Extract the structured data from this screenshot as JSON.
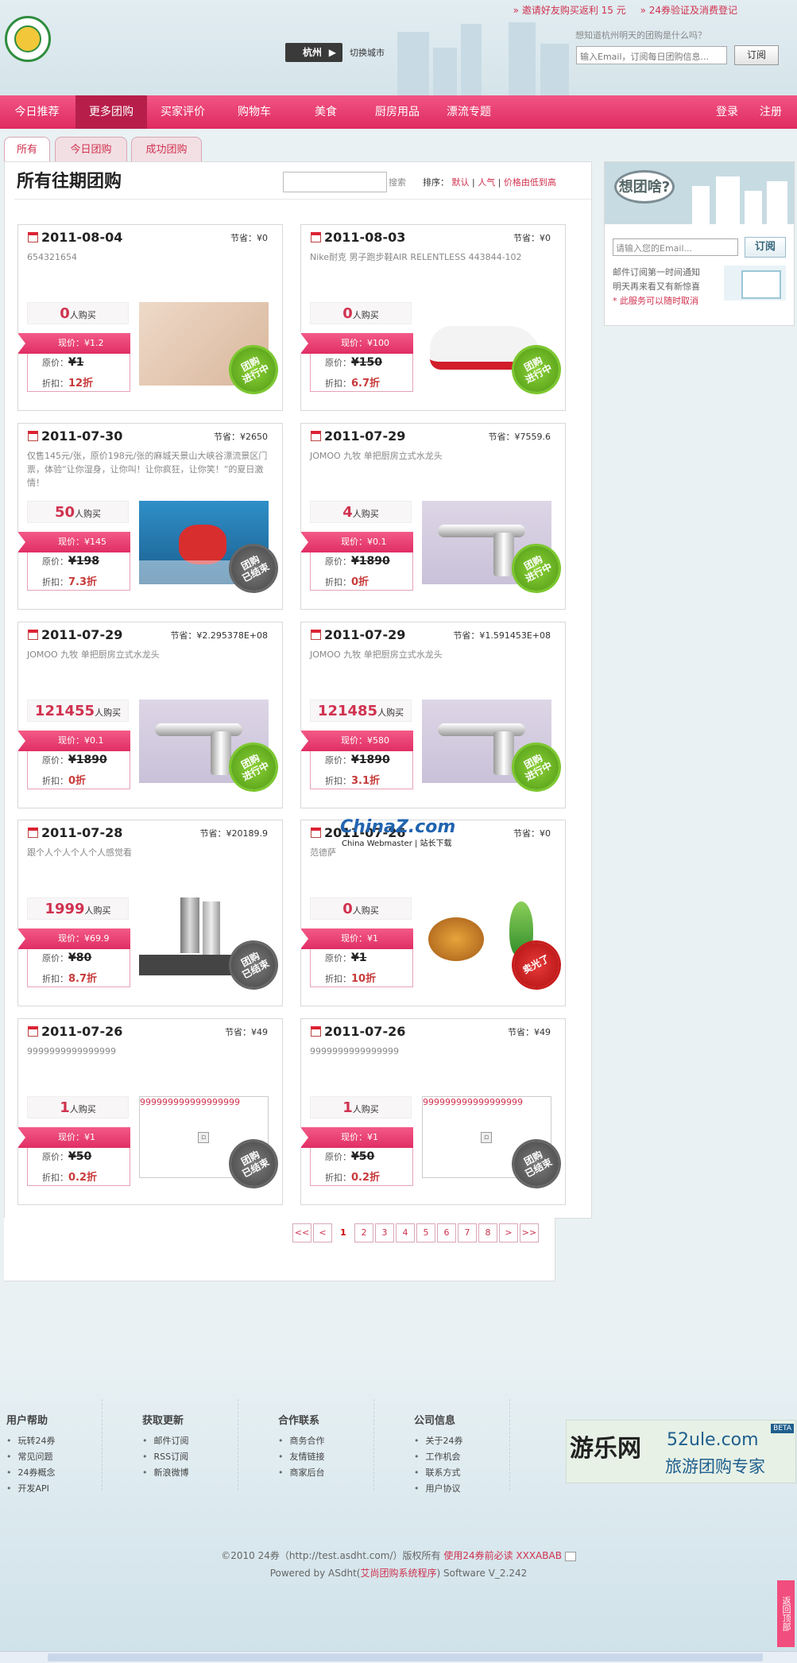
{
  "header": {
    "top_links": [
      "» 邀请好友购买返利 15 元",
      "» 24券验证及消费登记"
    ],
    "city": "杭州",
    "switch_city": "切换城市",
    "subscribe_question": "想知道杭州明天的团购是什么吗？",
    "email_placeholder": "输入Email，订阅每日团购信息...",
    "subscribe_button": "订阅"
  },
  "nav": {
    "items": [
      "今日推荐",
      "更多团购",
      "买家评价",
      "购物车",
      "美食",
      "厨房用品",
      "漂流专题"
    ],
    "active": "更多团购",
    "login": "登录",
    "register": "注册"
  },
  "tabs": [
    "所有",
    "今日团购",
    "成功团购"
  ],
  "main": {
    "title": "所有往期团购",
    "search_label": "搜索",
    "sort_label": "排序：",
    "sort_options": [
      "默认",
      "人气",
      "价格由低到高"
    ]
  },
  "labels": {
    "save": "节省：",
    "buyers": "人购买",
    "now_price": "现价：",
    "orig_price": "原价：",
    "discount": "折扣："
  },
  "deals": [
    {
      "date": "2011-08-04",
      "save": "¥0",
      "desc": "654321654",
      "buyers": "0",
      "now": "¥1.2",
      "orig": "¥1",
      "discount": "12折",
      "status": "团购\n进行中",
      "image": "shoes"
    },
    {
      "date": "2011-08-03",
      "save": "¥0",
      "desc": "Nike耐克 男子跑步鞋AIR RELENTLESS 443844-102",
      "buyers": "0",
      "now": "¥100",
      "orig": "¥150",
      "discount": "6.7折",
      "status": "团购\n进行中",
      "image": "sneaker"
    },
    {
      "date": "2011-07-30",
      "save": "¥2650",
      "desc": "仅售145元/张，原价198元/张的麻城天景山大峡谷漂流景区门票，体验“让你湿身，让你叫！让你疯狂，让你笑！”的夏日激情！",
      "buyers": "50",
      "now": "¥145",
      "orig": "¥198",
      "discount": "7.3折",
      "status": "团购\n已结束",
      "image": "rafting"
    },
    {
      "date": "2011-07-29",
      "save": "¥7559.6",
      "desc": "JOMOO 九牧 单把厨房立式水龙头",
      "buyers": "4",
      "now": "¥0.1",
      "orig": "¥1890",
      "discount": "0折",
      "status": "团购\n进行中",
      "image": "faucet"
    },
    {
      "date": "2011-07-29",
      "save": "¥2.295378E+08",
      "desc": "JOMOO 九牧 单把厨房立式水龙头",
      "buyers": "121455",
      "now": "¥0.1",
      "orig": "¥1890",
      "discount": "0折",
      "status": "团购\n进行中",
      "image": "faucet"
    },
    {
      "date": "2011-07-29",
      "save": "¥1.591453E+08",
      "desc": "JOMOO 九牧 单把厨房立式水龙头",
      "buyers": "121485",
      "now": "¥580",
      "orig": "¥1890",
      "discount": "3.1折",
      "status": "团购\n进行中",
      "image": "faucet"
    },
    {
      "date": "2011-07-28",
      "save": "¥20189.9",
      "desc": "跟个人个人个人个人感觉看",
      "buyers": "1999",
      "now": "¥69.9",
      "orig": "¥80",
      "discount": "8.7折",
      "status": "团购\n已结束",
      "image": "cosmetic"
    },
    {
      "date": "2011-07-26",
      "save": "¥0",
      "desc": "范德萨",
      "buyers": "0",
      "now": "¥1",
      "orig": "¥1",
      "discount": "10折",
      "status": "卖光了",
      "image": "food"
    },
    {
      "date": "2011-07-26",
      "save": "¥49",
      "desc": "9999999999999999",
      "buyers": "1",
      "now": "¥1",
      "orig": "¥50",
      "discount": "0.2折",
      "status": "团购\n已结束",
      "image": "broken",
      "alt": "999999999999999999"
    },
    {
      "date": "2011-07-26",
      "save": "¥49",
      "desc": "9999999999999999",
      "buyers": "1",
      "now": "¥1",
      "orig": "¥50",
      "discount": "0.2折",
      "status": "团购\n已结束",
      "image": "broken",
      "alt": "999999999999999999"
    }
  ],
  "pager": [
    "<<",
    "<",
    "1",
    "2",
    "3",
    "4",
    "5",
    "6",
    "7",
    "8",
    ">",
    ">>"
  ],
  "pager_current": "1",
  "sidebar": {
    "bubble": "想团啥?",
    "email_placeholder": "请输入您的Email...",
    "button": "订阅",
    "text": [
      "邮件订阅第一时间通知",
      "明天再来看又有新惊喜"
    ],
    "note": "* 此服务可以随时取消"
  },
  "watermark": {
    "logo": "ChinaZ.com",
    "sub": "China Webmaster | 站长下载"
  },
  "footer": {
    "columns": [
      {
        "title": "用户帮助",
        "items": [
          "玩转24券",
          "常见问题",
          "24券概念",
          "开发API"
        ]
      },
      {
        "title": "获取更新",
        "items": [
          "邮件订阅",
          "RSS订阅",
          "新浪微博"
        ]
      },
      {
        "title": "合作联系",
        "items": [
          "商务合作",
          "友情链接",
          "商家后台"
        ]
      },
      {
        "title": "公司信息",
        "items": [
          "关于24券",
          "工作机会",
          "联系方式",
          "用户协议"
        ]
      }
    ],
    "banner": {
      "cn": "游乐网",
      "en": "52ule.com",
      "slogan": "旅游团购专家",
      "beta": "BETA"
    },
    "copyright_a": "©2010 24券（http://test.asdht.com/）版权所有",
    "copyright_link": "使用24券前必读 XXXABAB",
    "powered_a": "Powered by ASdht(",
    "powered_link": "艾尚团购系统程序",
    "powered_b": ") Software V_2.242",
    "backtop": "返回顶部"
  }
}
